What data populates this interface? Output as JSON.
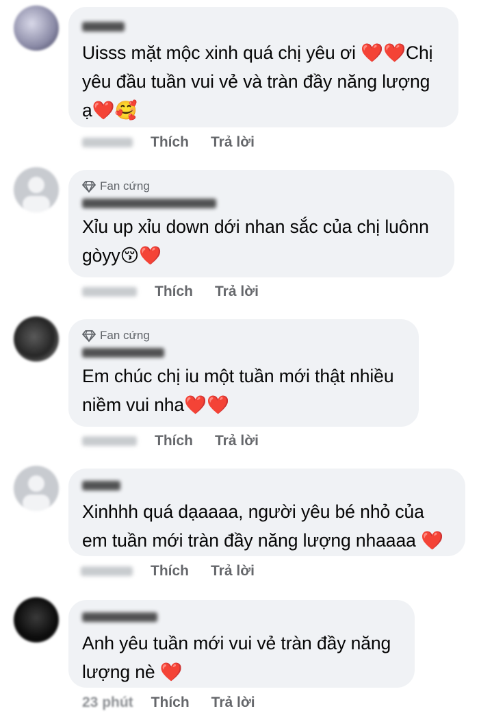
{
  "comments": [
    {
      "author": "",
      "badge": "",
      "text": "Uisss mặt mộc xinh quá chị yêu ơi ❤️❤️Chị yêu đầu tuần vui vẻ và tràn đầy năng lượng ạ❤️🥰",
      "time": "",
      "like_label": "Thích",
      "reply_label": "Trả lời",
      "avatar_icon": "blurred-profile-photo"
    },
    {
      "author": "",
      "badge": "Fan cứng",
      "text": "Xỉu up xỉu down dới nhan sắc của chị luônn gòyy😚❤️",
      "time": "",
      "like_label": "Thích",
      "reply_label": "Trả lời",
      "avatar_icon": "default-avatar-icon"
    },
    {
      "author": "",
      "badge": "Fan cứng",
      "text": "Em chúc chị iu một tuần mới thật nhiều niềm vui nha❤️❤️",
      "time": "",
      "like_label": "Thích",
      "reply_label": "Trả lời",
      "avatar_icon": "blurred-profile-photo"
    },
    {
      "author": "",
      "badge": "",
      "text": "Xinhhh quá dạaaaa, người yêu bé nhỏ của em tuần mới tràn đầy năng lượng nhaaaa ❤️",
      "time": "",
      "like_label": "Thích",
      "reply_label": "Trả lời",
      "avatar_icon": "default-avatar-icon"
    },
    {
      "author": "",
      "badge": "",
      "text": "Anh yêu tuần mới vui vẻ tràn đầy năng lượng nè ❤️",
      "time": "23 phút",
      "like_label": "Thích",
      "reply_label": "Trả lời",
      "avatar_icon": "blurred-profile-photo"
    }
  ],
  "colors": {
    "bubble": "#f0f2f5",
    "meta_text": "#65676b",
    "heart": "#e41e3f"
  }
}
